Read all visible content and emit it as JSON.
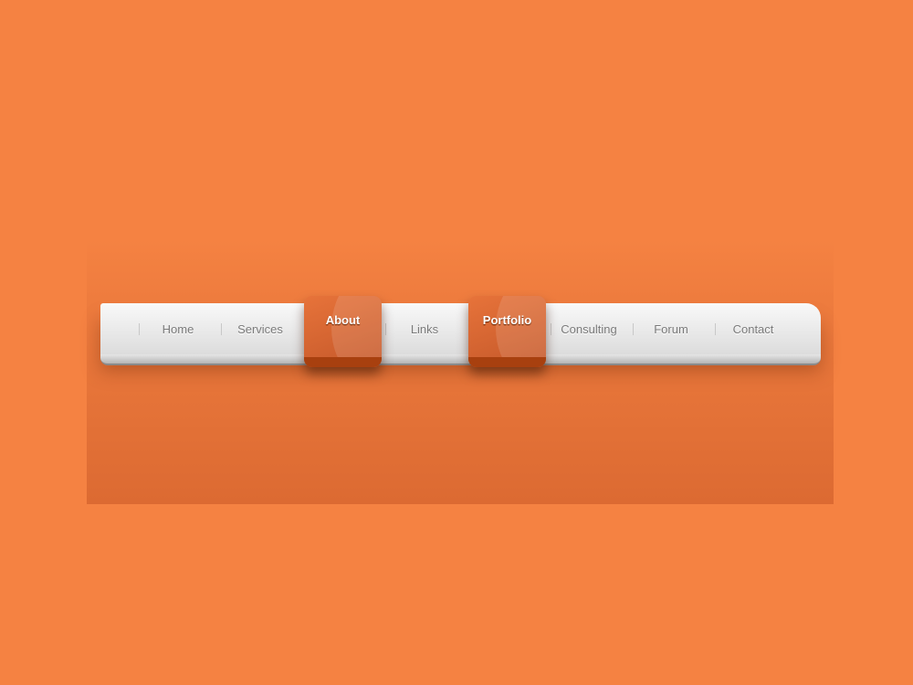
{
  "nav": {
    "items": [
      {
        "label": "Home",
        "active": false
      },
      {
        "label": "Services",
        "active": false
      },
      {
        "label": "About",
        "active": true
      },
      {
        "label": "Links",
        "active": false
      },
      {
        "label": "Portfolio",
        "active": true
      },
      {
        "label": "Consulting",
        "active": false
      },
      {
        "label": "Forum",
        "active": false
      },
      {
        "label": "Contact",
        "active": false
      }
    ]
  },
  "colors": {
    "background": "#f58242",
    "active": "#d9652f",
    "bar": "#f0f0f0"
  }
}
